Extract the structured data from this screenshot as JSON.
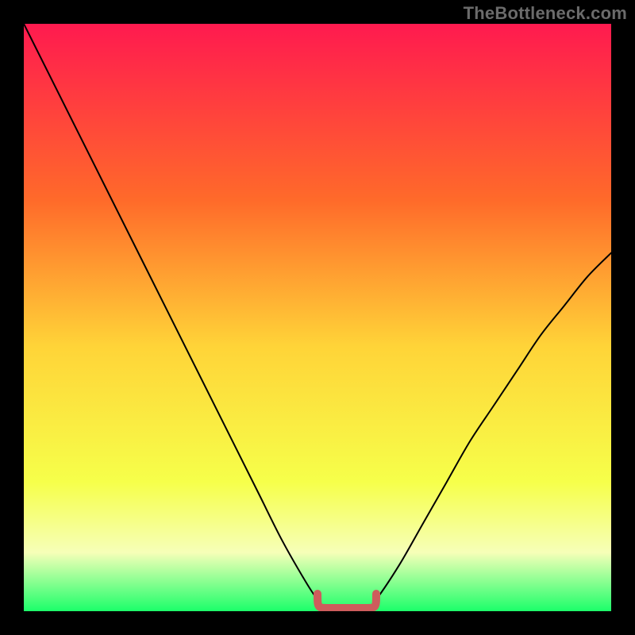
{
  "watermark": "TheBottleneck.com",
  "colors": {
    "background": "#000000",
    "watermark_text": "#6b6b6b",
    "curve": "#000000",
    "flat_segment": "#cd5c5c",
    "gradient_top": "#ff1a4f",
    "gradient_upper_mid": "#ff6a2a",
    "gradient_mid": "#ffd438",
    "gradient_lower_mid": "#f6ff4a",
    "gradient_pale": "#f6ffb8",
    "gradient_bottom": "#1cff6a"
  },
  "chart_data": {
    "type": "line",
    "title": "",
    "xlabel": "",
    "ylabel": "",
    "x_range": [
      0,
      100
    ],
    "y_range": [
      0,
      100
    ],
    "series": [
      {
        "name": "bottleneck_curve",
        "x": [
          0,
          4,
          8,
          12,
          16,
          20,
          24,
          28,
          32,
          36,
          40,
          44,
          48,
          50,
          52,
          54,
          56,
          58,
          60,
          64,
          68,
          72,
          76,
          80,
          84,
          88,
          92,
          96,
          100
        ],
        "values": [
          100,
          92,
          84,
          76,
          68,
          60,
          52,
          44,
          36,
          28,
          20,
          12,
          5,
          2,
          0,
          0,
          0,
          0,
          2,
          8,
          15,
          22,
          29,
          35,
          41,
          47,
          52,
          57,
          61
        ]
      }
    ],
    "flat_segment": {
      "x_start": 50,
      "x_end": 60,
      "y": 0
    },
    "notes": "V-shaped curve on a vertical red→orange→yellow→pale→green gradient. No axis ticks or labels are visible; all numeric values are normalized estimates (0–100)."
  }
}
